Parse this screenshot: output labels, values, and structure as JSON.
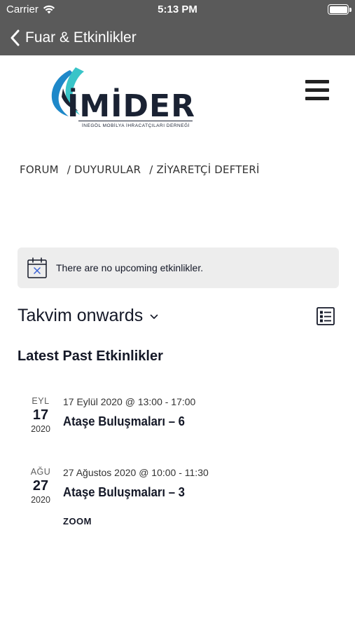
{
  "status_bar": {
    "carrier": "Carrier",
    "time": "5:13 PM"
  },
  "nav_bar": {
    "title": "Fuar & Etkinlikler"
  },
  "logo": {
    "wordmark": "İMİDER",
    "subtitle": "İNEGÖL MOBİLYA İHRACATÇILARI DERNEĞİ"
  },
  "top_nav": {
    "items": [
      {
        "label": "FORUM"
      },
      {
        "label": "/ DUYURULAR"
      },
      {
        "label": "/ ZİYARETÇİ DEFTERİ"
      }
    ]
  },
  "notice": {
    "text": "There are no upcoming etkinlikler."
  },
  "view_selector": {
    "label": "Takvim onwards"
  },
  "past_events": {
    "heading": "Latest Past Etkinlikler",
    "items": [
      {
        "month": "EYL",
        "day": "17",
        "year": "2020",
        "datetime": "17 Eylül 2020 @ 13:00 - 17:00",
        "title": "Ataşe Buluşmaları – 6",
        "venue": ""
      },
      {
        "month": "AĞU",
        "day": "27",
        "year": "2020",
        "datetime": "27 Ağustos 2020 @ 10:00 - 11:30",
        "title": "Ataşe Buluşmaları – 3",
        "venue": "ZOOM"
      }
    ]
  },
  "colors": {
    "bar_background": "#5a5a5a",
    "notice_background": "#ededed",
    "text_primary": "#141827",
    "logo_blue": "#1e88c9",
    "logo_teal": "#39c4c8",
    "logo_navy": "#1a2233"
  }
}
